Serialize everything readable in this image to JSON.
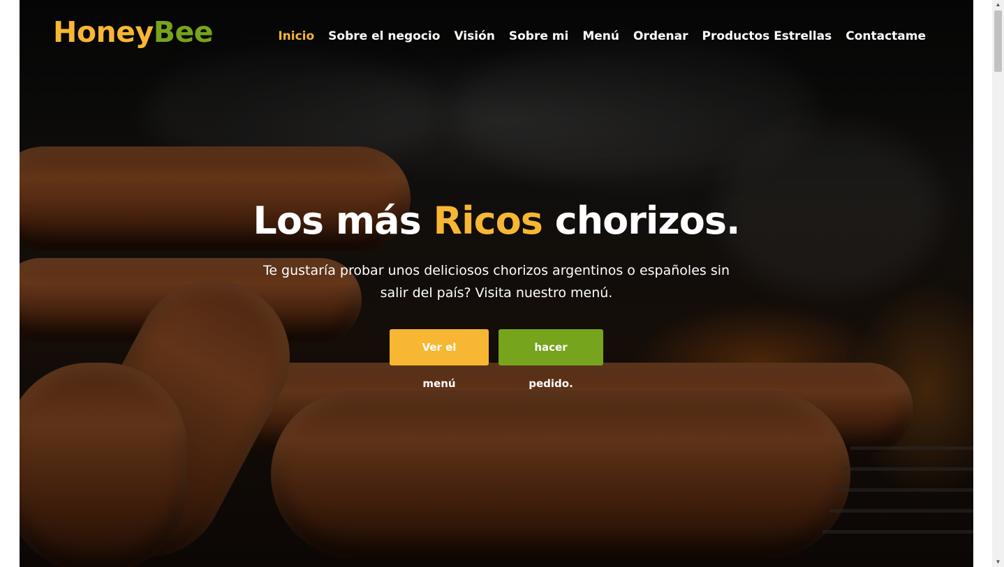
{
  "brand": {
    "part1": "Honey",
    "part2": "Bee"
  },
  "nav": {
    "items": [
      {
        "label": "Inicio",
        "active": true
      },
      {
        "label": "Sobre el negocio",
        "active": false
      },
      {
        "label": "Visión",
        "active": false
      },
      {
        "label": "Sobre mi",
        "active": false
      },
      {
        "label": "Menú",
        "active": false
      },
      {
        "label": "Ordenar",
        "active": false
      },
      {
        "label": "Productos Estrellas",
        "active": false
      },
      {
        "label": "Contactame",
        "active": false
      }
    ]
  },
  "hero": {
    "headline_before": "Los más",
    "headline_accent": "Ricos",
    "headline_after": "chorizos.",
    "subtitle": "Te gustaría probar unos deliciosos chorizos argentinos o españoles sin salir del país? Visita nuestro menú.",
    "primary_button": "Ver el menú",
    "secondary_button": "hacer pedido."
  },
  "colors": {
    "accent": "#f7b733",
    "green": "#76a41c",
    "text": "#ffffff"
  },
  "scrollbar": {
    "up_icon": "chevron-up-icon",
    "down_icon": "chevron-down-icon"
  }
}
